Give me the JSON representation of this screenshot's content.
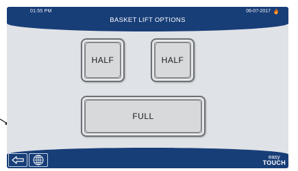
{
  "status_bar": {
    "time": "01:55 PM",
    "date": "06-07-2017",
    "flame_icon": "flame-icon"
  },
  "header": {
    "title": "BASKET LIFT OPTIONS"
  },
  "options": {
    "half_left_label": "HALF",
    "half_right_label": "HALF",
    "full_label": "FULL"
  },
  "footer": {
    "back_icon": "back-arrow-icon",
    "language_icon": "globe-icon",
    "brand_line1": "easy",
    "brand_line2": "TOUCH"
  },
  "colors": {
    "bar_blue": "#183e78",
    "screen_bg": "#dfe2e6",
    "button_face": "#d8d9db",
    "flame": "#e8701a"
  }
}
